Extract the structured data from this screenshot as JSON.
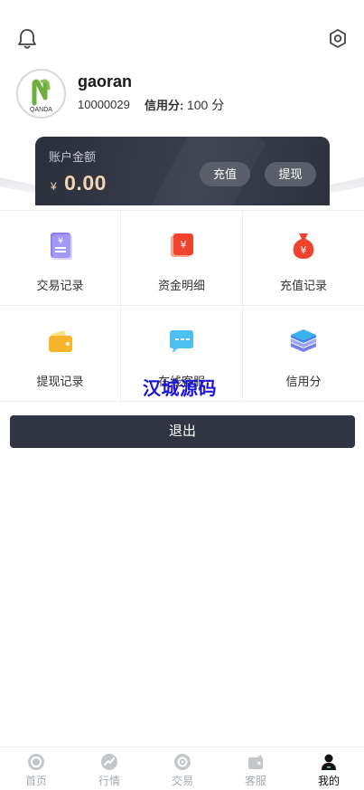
{
  "header": {
    "icons": [
      "bell-icon",
      "settings-icon"
    ]
  },
  "profile": {
    "avatar_text": "QANDA",
    "username": "gaoran",
    "uid": "10000029",
    "credit_label": "信用分:",
    "credit_value": "100 分"
  },
  "account_card": {
    "label": "账户金额",
    "currency": "¥",
    "amount": "0.00",
    "recharge_label": "充值",
    "withdraw_label": "提现"
  },
  "menu": [
    {
      "label": "交易记录",
      "icon": "transaction-record-icon"
    },
    {
      "label": "资金明细",
      "icon": "fund-detail-icon"
    },
    {
      "label": "充值记录",
      "icon": "recharge-record-icon"
    },
    {
      "label": "提现记录",
      "icon": "withdraw-record-icon"
    },
    {
      "label": "在线客服",
      "icon": "online-service-icon"
    },
    {
      "label": "信用分",
      "icon": "credit-score-icon"
    }
  ],
  "watermark": "汉城源码",
  "logout_label": "退出",
  "tabs": [
    {
      "label": "首页",
      "icon": "home-icon"
    },
    {
      "label": "行情",
      "icon": "market-icon"
    },
    {
      "label": "交易",
      "icon": "trade-icon"
    },
    {
      "label": "客服",
      "icon": "service-icon"
    },
    {
      "label": "我的",
      "icon": "profile-icon",
      "active": true
    }
  ],
  "colors": {
    "card_bg": "#2b2f3a",
    "amount": "#f2d3b4",
    "button_dark": "#2f3543",
    "tab_inactive": "#a7acb3",
    "watermark": "#1c14d8"
  }
}
